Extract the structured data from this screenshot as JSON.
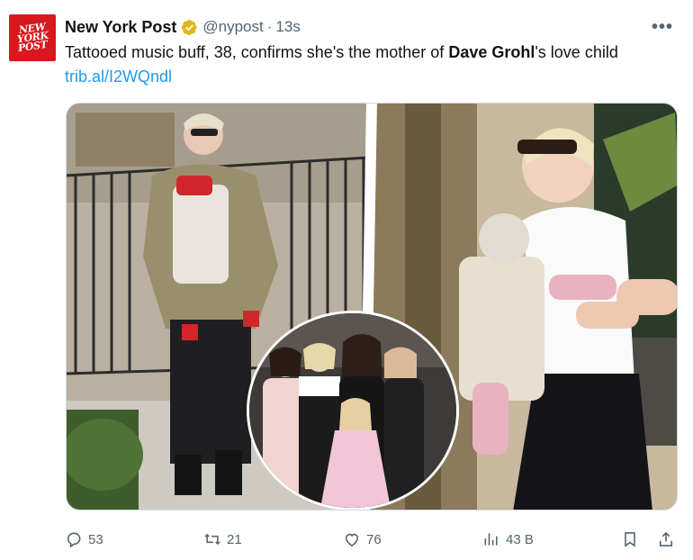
{
  "tweet": {
    "avatar_text": [
      "NEW",
      "YORK",
      "POST"
    ],
    "author_name": "New York Post",
    "handle": "@nypost",
    "separator": "·",
    "time": "13s",
    "more_label": "•••",
    "text_part1": "Tattooed music buff, 38, confirms she's the mother of ",
    "text_bold": "Dave Grohl",
    "text_part2": "'s love child ",
    "link_text": "trib.al/I2WQndl"
  },
  "media": {
    "left_photo": "woman walking with baby carrier",
    "right_photo": "woman holding baby in carrier",
    "inset_photo": "family group photo"
  },
  "actions": {
    "replies": "53",
    "reposts": "21",
    "likes": "76",
    "views": "43 B"
  },
  "colors": {
    "brand_red": "#d7191f",
    "link_blue": "#1d9bf0",
    "verified_gold": "#e2b719",
    "muted": "#536471"
  },
  "icons": [
    "reply-icon",
    "repost-icon",
    "like-icon",
    "views-icon",
    "bookmark-icon",
    "share-icon",
    "verified-icon",
    "more-icon"
  ]
}
